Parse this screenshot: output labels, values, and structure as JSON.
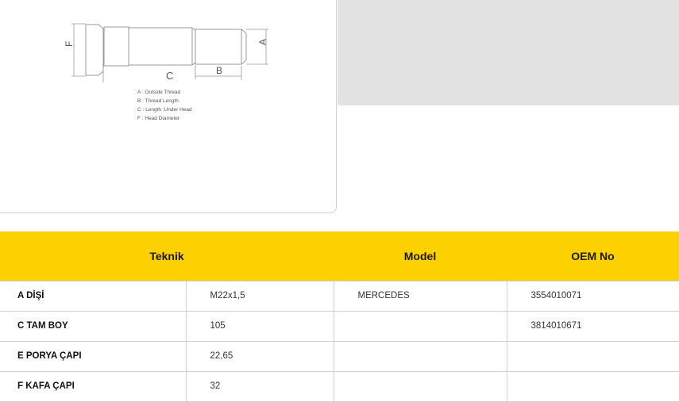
{
  "diagram": {
    "dims": {
      "A": "A",
      "B": "B",
      "C": "C",
      "F": "F"
    },
    "legend": [
      "A : Outside Thread",
      "B : Thread Length",
      "C : Length :Under Head",
      "F : Head Diameter"
    ]
  },
  "table": {
    "headers": {
      "teknik": "Teknik",
      "model": "Model",
      "oem": "OEM No"
    },
    "rows": [
      {
        "label": "A DİŞİ",
        "value": "M22x1,5",
        "model": "MERCEDES",
        "oem": "3554010071"
      },
      {
        "label": "C TAM BOY",
        "value": "105",
        "model": "",
        "oem": "3814010671"
      },
      {
        "label": "E PORYA ÇAPI",
        "value": "22,65",
        "model": "",
        "oem": ""
      },
      {
        "label": "F KAFA ÇAPI",
        "value": "32",
        "model": "",
        "oem": ""
      }
    ]
  }
}
